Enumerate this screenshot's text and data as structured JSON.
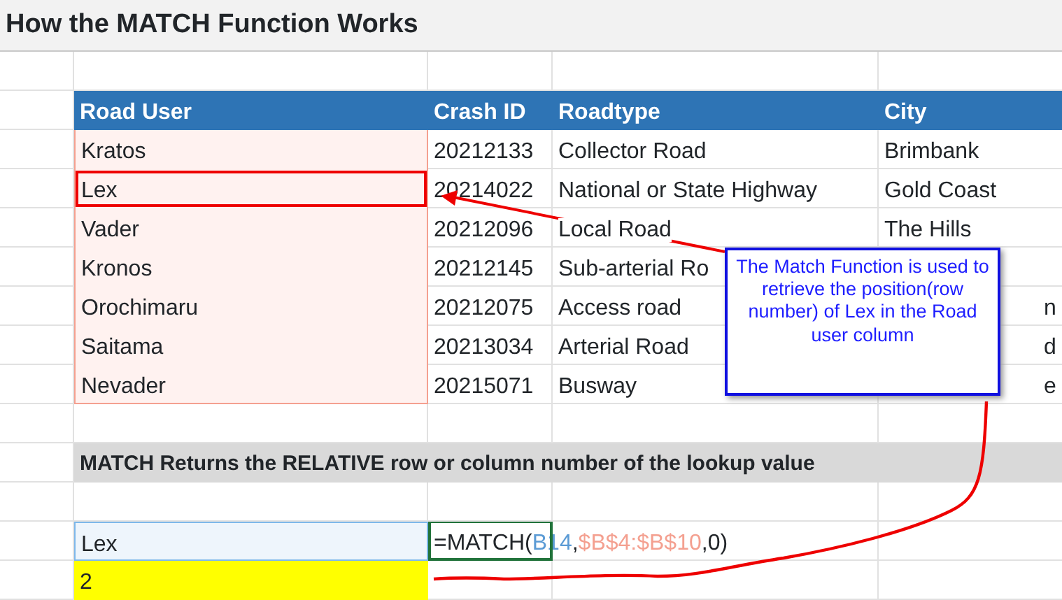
{
  "title": "How the MATCH Function Works",
  "table": {
    "columns": [
      "Road User",
      "Crash ID",
      "Roadtype",
      "City"
    ],
    "rows": [
      {
        "cells": [
          "Kratos",
          "20212133",
          "Collector Road",
          "Brimbank"
        ],
        "boxed": false
      },
      {
        "cells": [
          "Lex",
          "20214022",
          "National or State Highway",
          "Gold Coast"
        ],
        "boxed": true
      },
      {
        "cells": [
          "Vader",
          "20212096",
          "Local Road",
          "The Hills"
        ],
        "boxed": false
      },
      {
        "cells": [
          "Kronos",
          "20212145",
          "Sub-arterial Ro",
          ""
        ],
        "boxed": false
      },
      {
        "cells": [
          "Orochimaru",
          "20212075",
          "Access road",
          "n"
        ],
        "boxed": false
      },
      {
        "cells": [
          "Saitama",
          "20213034",
          "Arterial Road",
          "d"
        ],
        "boxed": false
      },
      {
        "cells": [
          "Nevader",
          "20215071",
          "Busway",
          "e"
        ],
        "boxed": false
      }
    ]
  },
  "callout": "The Match Function is used to retrieve the position(row number) of Lex in the Road user column",
  "note": "MATCH Returns the RELATIVE row or column number of the lookup value",
  "lookup_value": "Lex",
  "formula": [
    {
      "text": "=MATCH("
    },
    {
      "text": "B14",
      "color": "#5b9bd5"
    },
    {
      "text": ","
    },
    {
      "text": "$B$4:$B$10",
      "color": "#f4a090"
    },
    {
      "text": ",0)"
    }
  ],
  "result": "2"
}
